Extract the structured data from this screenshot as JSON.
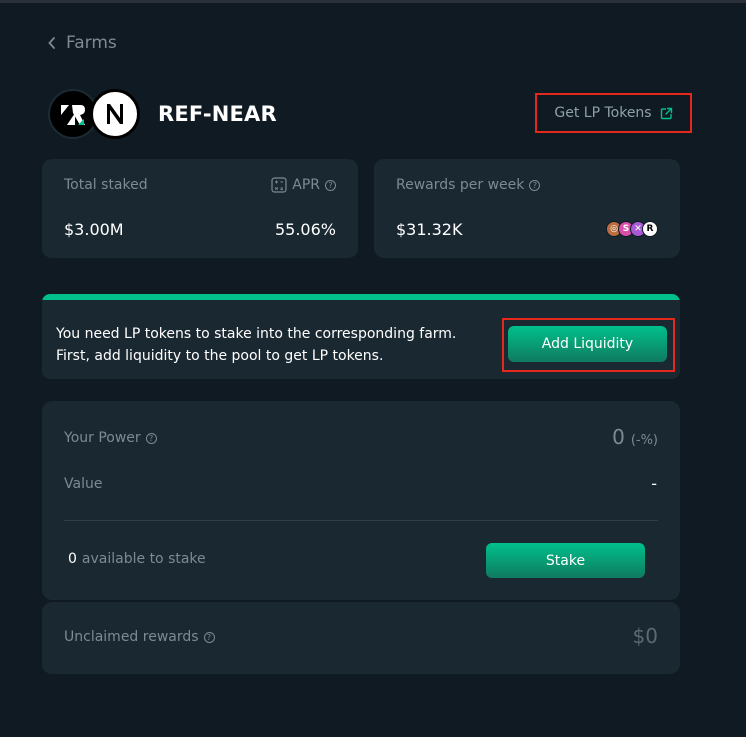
{
  "nav": {
    "back_label": "Farms"
  },
  "pair": {
    "name": "REF-NEAR"
  },
  "get_lp": {
    "label": "Get LP Tokens"
  },
  "stats": {
    "total_staked_label": "Total staked",
    "total_staked_value": "$3.00M",
    "apr_label": "APR",
    "apr_value": "55.06%",
    "rewards_label": "Rewards per week",
    "rewards_value": "$31.32K"
  },
  "notice": {
    "text": "You need LP tokens to stake into the corresponding farm. First, add liquidity to the pool to get LP tokens.",
    "button_label": "Add Liquidity"
  },
  "power": {
    "label": "Your Power",
    "value": "0",
    "percent": "(-%)",
    "value_label": "Value",
    "value_value": "-",
    "available_amount": "0",
    "available_label": "available to stake",
    "stake_label": "Stake"
  },
  "unclaimed": {
    "label": "Unclaimed rewards",
    "value": "$0"
  },
  "colors": {
    "accent": "#00c08b",
    "highlight": "#e5281c",
    "card": "#1a2832",
    "background": "#0f1a22"
  }
}
